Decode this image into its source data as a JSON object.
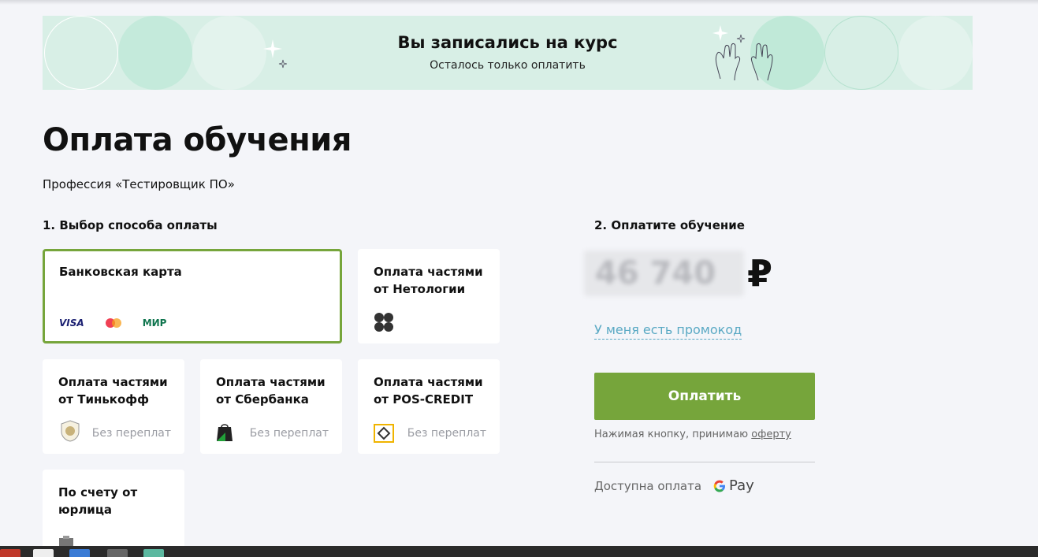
{
  "banner": {
    "title": "Вы записались на курс",
    "subtitle": "Осталось только оплатить"
  },
  "page": {
    "title": "Оплата обучения",
    "subtitle": "Профессия «Тестировщик ПО»"
  },
  "step1": {
    "label": "1. Выбор способа оплаты",
    "methods": [
      {
        "title": "Банковская карта",
        "logos": [
          "VISA",
          "mastercard-icon",
          "МИР"
        ],
        "selected": true
      },
      {
        "title": "Оплата частями от Нетологии",
        "icon": "netology-logo-icon"
      },
      {
        "title": "Оплата частями от Тинькофф",
        "icon": "tinkoff-logo-icon",
        "note": "Без переплат"
      },
      {
        "title": "Оплата частями от Сбербанка",
        "icon": "sber-logo-icon",
        "note": "Без переплат"
      },
      {
        "title": "Оплата частями от POS-CREDIT",
        "icon": "pos-credit-logo-icon",
        "note": "Без переплат"
      },
      {
        "title": "По счету от юрлица",
        "icon": "document-icon"
      }
    ]
  },
  "step2": {
    "label": "2. Оплатите обучение",
    "price": "46 740",
    "currency": "₽",
    "promo_link": "У меня есть промокод",
    "pay_button": "Оплатить",
    "terms_prefix": "Нажимая кнопку, принимаю ",
    "terms_link": "оферту",
    "available_label": "Доступна оплата",
    "gpay_label": "Pay"
  },
  "colors": {
    "accent": "#76a53b",
    "link": "#5aa9c4",
    "banner_bg": "#d8efe6"
  }
}
